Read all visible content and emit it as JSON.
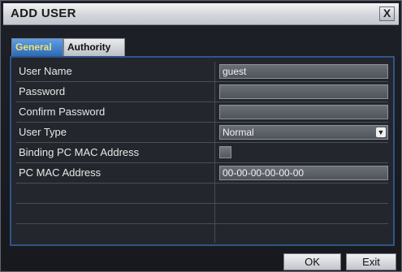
{
  "window": {
    "title": "ADD USER",
    "close_glyph": "X"
  },
  "tabs": [
    {
      "label": "General",
      "active": true
    },
    {
      "label": "Authority",
      "active": false
    }
  ],
  "fields": [
    {
      "label": "User Name",
      "type": "text",
      "value": "guest"
    },
    {
      "label": "Password",
      "type": "password",
      "value": ""
    },
    {
      "label": "Confirm Password",
      "type": "password",
      "value": ""
    },
    {
      "label": "User Type",
      "type": "select",
      "value": "Normal"
    },
    {
      "label": "Binding PC MAC Address",
      "type": "checkbox",
      "checked": false
    },
    {
      "label": "PC MAC Address",
      "type": "text",
      "value": "00-00-00-00-00-00"
    }
  ],
  "buttons": {
    "ok": "OK",
    "exit": "Exit"
  },
  "colors": {
    "active_tab": "#2c6ab5",
    "active_tab_text": "#f0e070",
    "panel_border": "#31548a"
  }
}
